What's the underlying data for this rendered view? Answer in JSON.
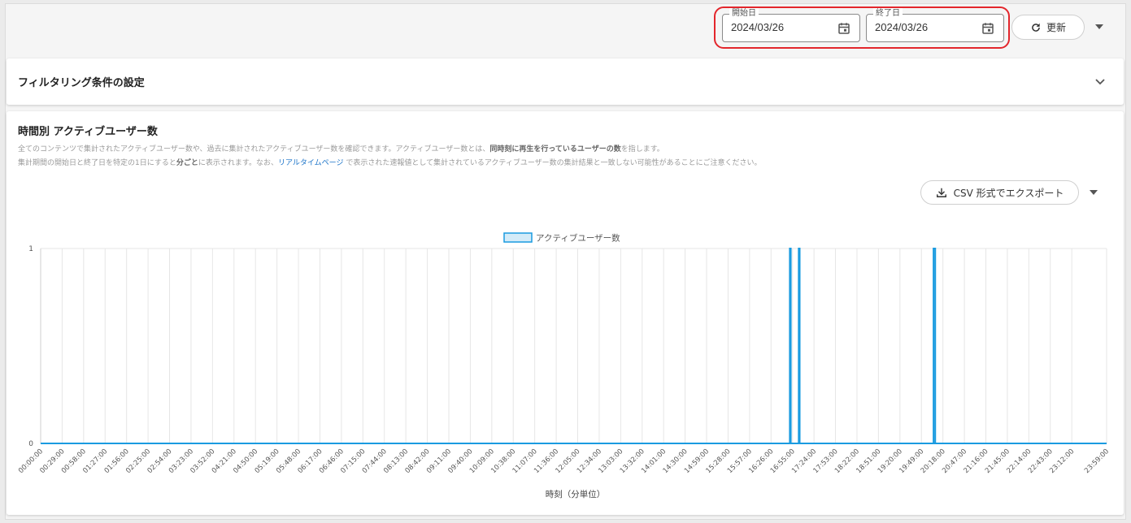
{
  "toolbar": {
    "start_date": {
      "label": "開始日",
      "value": "2024/03/26"
    },
    "end_date": {
      "label": "終了日",
      "value": "2024/03/26"
    },
    "refresh_label": "更新"
  },
  "filter": {
    "title": "フィルタリング条件の設定"
  },
  "chart_section": {
    "title": "時間別 アクティブユーザー数",
    "desc1_a": "全てのコンテンツで集計されたアクティブユーザー数や、過去に集計されたアクティブユーザー数を確認できます。アクティブユーザー数とは、",
    "desc1_b": "同時刻に再生を行っているユーザーの数",
    "desc1_c": "を指します。",
    "desc2_a": "集計期間の開始日と終了日を特定の1日にすると",
    "desc2_b": "分ごと",
    "desc2_c": "に表示されます。なお、",
    "desc2_link": "リアルタイムページ",
    "desc2_d": " で表示された速報値として集計されているアクティブユーザー数の集計結果と一致しない可能性があることにご注意ください。",
    "export_label": "CSV 形式でエクスポート"
  },
  "colors": {
    "accent": "#1a9be0",
    "fill": "#d3ebf8",
    "highlight": "#e3262c"
  },
  "chart_data": {
    "type": "area",
    "xlabel": "時刻（分単位）",
    "ylabel": "",
    "ylim": [
      0,
      1
    ],
    "yticks": [
      "0",
      "1"
    ],
    "x_tick_labels": [
      "00:00:00",
      "00:29:00",
      "00:58:00",
      "01:27:00",
      "01:56:00",
      "02:25:00",
      "02:54:00",
      "03:23:00",
      "03:52:00",
      "04:21:00",
      "04:50:00",
      "05:19:00",
      "05:48:00",
      "06:17:00",
      "06:46:00",
      "07:15:00",
      "07:44:00",
      "08:13:00",
      "08:42:00",
      "09:11:00",
      "09:40:00",
      "10:09:00",
      "10:38:00",
      "11:07:00",
      "11:36:00",
      "12:05:00",
      "12:34:00",
      "13:03:00",
      "13:32:00",
      "14:01:00",
      "14:30:00",
      "14:59:00",
      "15:28:00",
      "15:57:00",
      "16:26:00",
      "16:55:00",
      "17:24:00",
      "17:53:00",
      "18:22:00",
      "18:51:00",
      "19:20:00",
      "19:49:00",
      "20:18:00",
      "20:47:00",
      "21:16:00",
      "21:45:00",
      "22:14:00",
      "22:43:00",
      "23:12:00",
      "23:59:00"
    ],
    "series": [
      {
        "name": "アクティブユーザー数",
        "baseline": 0,
        "nonzero_points": [
          {
            "x": "16:52:00",
            "y": 1
          },
          {
            "x": "17:04:00",
            "y": 1
          },
          {
            "x": "20:06:00",
            "y": 1
          },
          {
            "x": "20:07:00",
            "y": 1
          }
        ]
      }
    ],
    "grid": true,
    "legend": "top-center"
  }
}
